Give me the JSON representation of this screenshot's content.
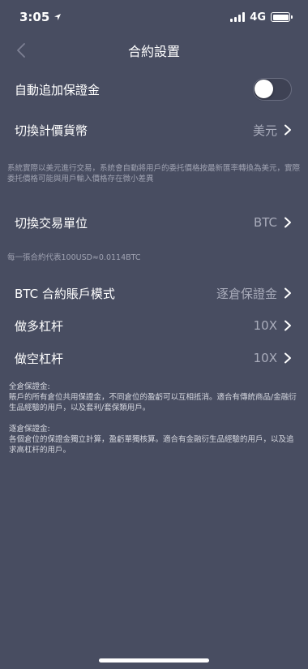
{
  "status_bar": {
    "time": "3:05",
    "network": "4G"
  },
  "nav": {
    "title": "合約設置"
  },
  "settings": {
    "auto_margin": {
      "label": "自動追加保證金",
      "enabled": false
    },
    "quote_currency": {
      "label": "切換計價貨幣",
      "value": "美元"
    },
    "quote_currency_note": "系統實際以美元進行交易，系統會自動將用戶的委托價格按最新匯率轉換為美元，實際委托價格可能與用戶輸入價格存在微小差異",
    "trade_unit": {
      "label": "切換交易單位",
      "value": "BTC"
    },
    "trade_unit_note": "每一張合約代表100USD≈0.0114BTC",
    "account_mode": {
      "label": "BTC 合約賬戶模式",
      "value": "逐倉保證金"
    },
    "long_leverage": {
      "label": "做多杠杆",
      "value": "10X"
    },
    "short_leverage": {
      "label": "做空杠杆",
      "value": "10X"
    }
  },
  "explanations": {
    "cross_title": "全倉保證金:",
    "cross_text": "賬戶的所有倉位共用保證金，不同倉位的盈虧可以互相抵消。適合有傳統商品/金融衍生品經驗的用戶，以及套利/套保類用戶。",
    "isolated_title": "逐倉保證金:",
    "isolated_text": "各個倉位的保證金獨立計算，盈虧單獨核算。適合有金融衍生品經驗的用戶，以及追求高杠杆的用戶。"
  },
  "colors": {
    "background": "#484d61",
    "text_primary": "#ffffff",
    "text_secondary": "#a9acbb"
  },
  "icons": {
    "back": "chevron-left-icon",
    "row_arrow": "chevron-right-icon",
    "location": "location-arrow-icon",
    "signal": "cellular-signal-icon",
    "battery": "battery-icon"
  }
}
